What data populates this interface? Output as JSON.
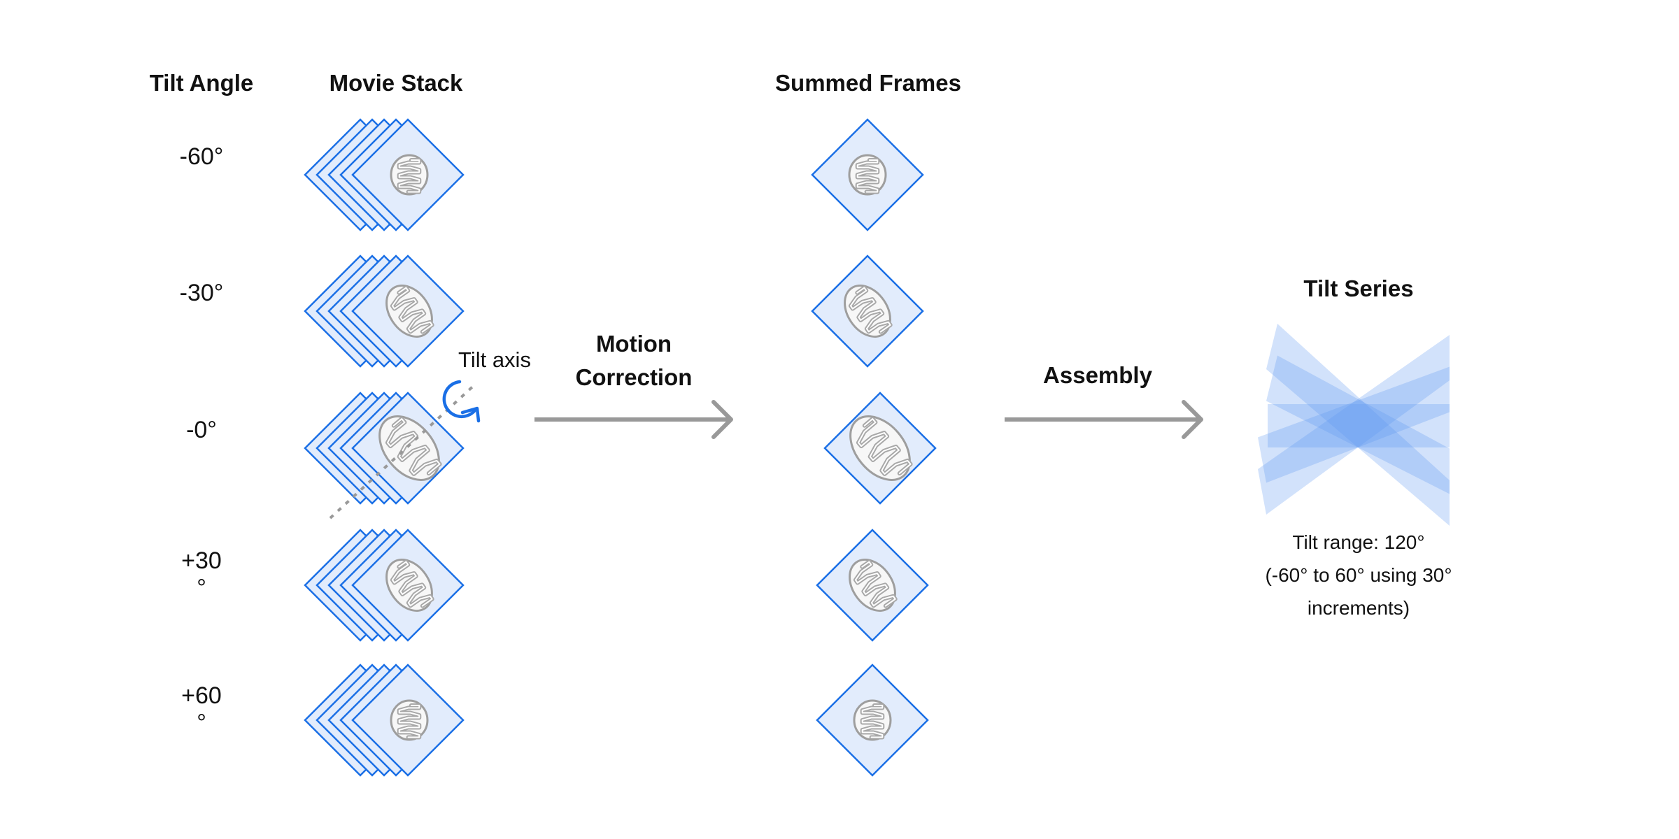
{
  "headers": {
    "tilt_angle": "Tilt Angle",
    "movie_stack": "Movie Stack",
    "summed_frames": "Summed Frames",
    "tilt_series": "Tilt Series"
  },
  "rows": [
    {
      "label_lines": [
        "-60°"
      ]
    },
    {
      "label_lines": [
        "-30°"
      ]
    },
    {
      "label_lines": [
        "-0°"
      ]
    },
    {
      "label_lines": [
        "+30",
        "°"
      ]
    },
    {
      "label_lines": [
        "+60",
        "°"
      ]
    }
  ],
  "tilt_axis_label": "Tilt axis",
  "steps": {
    "motion_correction": [
      "Motion",
      "Correction"
    ],
    "assembly": "Assembly"
  },
  "tilt_range_lines": [
    "Tilt range: 120°",
    "(-60° to 60° using 30°",
    "increments)"
  ],
  "icons": {
    "rotation": "rotate-arrow-icon",
    "arrow": "right-arrow-icon",
    "organelle": "mitochondrion-icon"
  },
  "colors": {
    "frame_stroke": "#1a6fe6",
    "frame_fill": "#e2ecfc",
    "arrow": "#999999",
    "tilt_series_fill": "#5c98f2",
    "mito_outline": "#9e9e9e"
  }
}
